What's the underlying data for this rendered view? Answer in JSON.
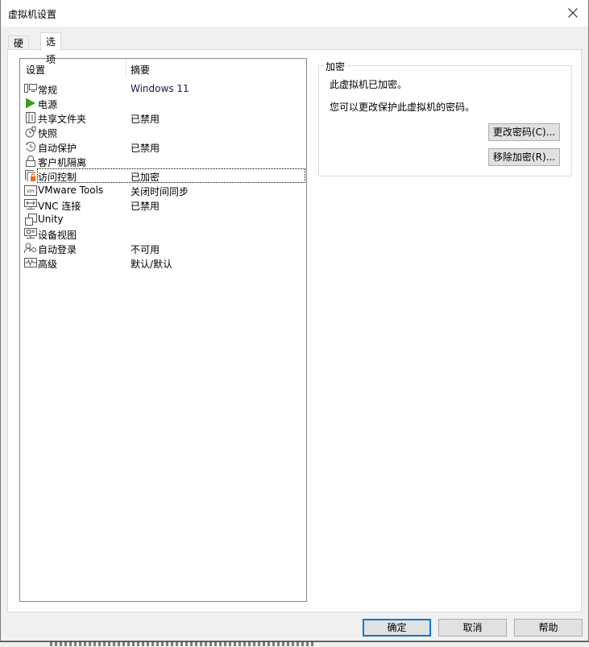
{
  "window": {
    "title": "虚拟机设置",
    "close_icon": "close-icon"
  },
  "tabs": [
    {
      "label": "硬件",
      "active": false
    },
    {
      "label": "选项",
      "active": true
    }
  ],
  "settings_list": {
    "columns": [
      "设置",
      "摘要"
    ],
    "items": [
      {
        "icon": "monitor-icon",
        "name": "常规",
        "summary": "Windows 11"
      },
      {
        "icon": "power-play-icon",
        "name": "电源",
        "summary": ""
      },
      {
        "icon": "shared-folder-icon",
        "name": "共享文件夹",
        "summary": "已禁用"
      },
      {
        "icon": "snapshot-icon",
        "name": "快照",
        "summary": ""
      },
      {
        "icon": "autoprotect-clock-icon",
        "name": "自动保护",
        "summary": "已禁用"
      },
      {
        "icon": "lock-icon",
        "name": "客户机隔离",
        "summary": ""
      },
      {
        "icon": "access-control-icon",
        "name": "访问控制",
        "summary": "已加密",
        "selected": true
      },
      {
        "icon": "vmware-tools-icon",
        "name": "VMware Tools",
        "summary": "关闭时间同步"
      },
      {
        "icon": "vnc-icon",
        "name": "VNC 连接",
        "summary": "已禁用"
      },
      {
        "icon": "unity-icon",
        "name": "Unity",
        "summary": ""
      },
      {
        "icon": "device-view-icon",
        "name": "设备视图",
        "summary": ""
      },
      {
        "icon": "autologin-icon",
        "name": "自动登录",
        "summary": "不可用"
      },
      {
        "icon": "advanced-icon",
        "name": "高级",
        "summary": "默认/默认"
      }
    ]
  },
  "encryption": {
    "legend": "加密",
    "status_text": "此虚拟机已加密。",
    "info_text": "您可以更改保护此虚拟机的密码。",
    "change_password_label": "更改密码(C)...",
    "remove_encryption_label": "移除加密(R)..."
  },
  "footer": {
    "ok_label": "确定",
    "cancel_label": "取消",
    "help_label": "帮助"
  },
  "colors": {
    "accent": "#0078d7",
    "power_green": "#3c9a1e",
    "lock_orange": "#f26b1d"
  }
}
